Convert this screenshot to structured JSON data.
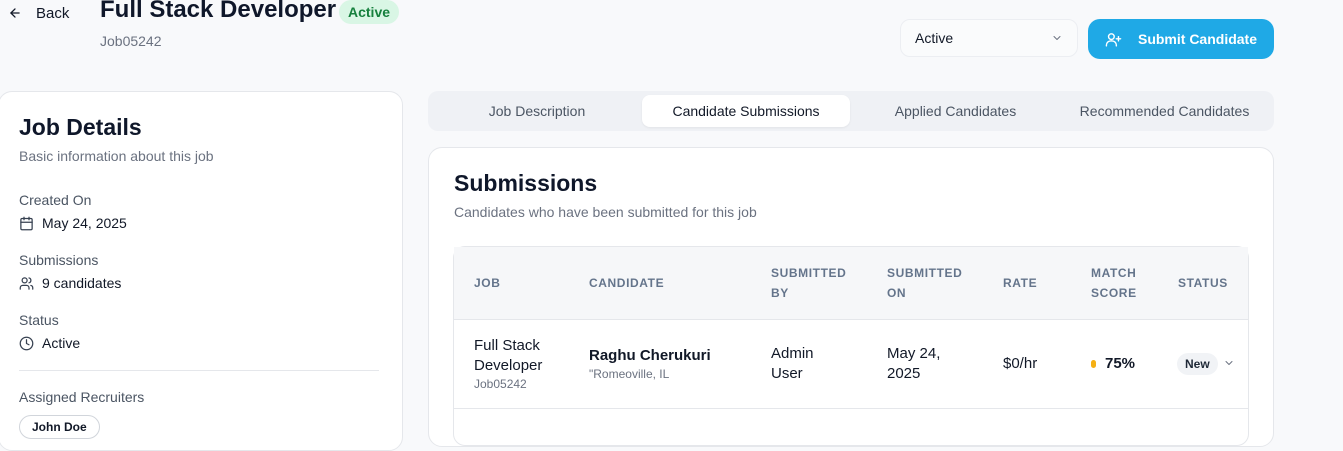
{
  "header": {
    "back_label": "Back",
    "title": "Full Stack Developer",
    "status_badge": "Active",
    "job_id": "Job05242",
    "status_select_value": "Active",
    "submit_label": "Submit Candidate"
  },
  "job_details": {
    "title": "Job Details",
    "subtitle": "Basic information about this job",
    "created_label": "Created On",
    "created_value": "May 24, 2025",
    "submissions_label": "Submissions",
    "submissions_value": "9 candidates",
    "status_label": "Status",
    "status_value": "Active",
    "recruiters_label": "Assigned Recruiters",
    "recruiters": [
      "John Doe"
    ]
  },
  "tabs": [
    {
      "label": "Job Description",
      "active": false
    },
    {
      "label": "Candidate Submissions",
      "active": true
    },
    {
      "label": "Applied Candidates",
      "active": false
    },
    {
      "label": "Recommended Candidates",
      "active": false
    }
  ],
  "submissions": {
    "title": "Submissions",
    "description": "Candidates who have been submitted for this job",
    "columns": [
      [
        "JOB"
      ],
      [
        "CANDIDATE"
      ],
      [
        "SUBMITTED",
        "BY"
      ],
      [
        "SUBMITTED",
        "ON"
      ],
      [
        "RATE"
      ],
      [
        "MATCH",
        "SCORE"
      ],
      [
        "STATUS"
      ]
    ],
    "rows": [
      {
        "job_title_line1": "Full Stack",
        "job_title_line2": "Developer",
        "job_id": "Job05242",
        "candidate_name": "Raghu Cherukuri",
        "candidate_location": "\"Romeoville, IL",
        "submitted_by_line1": "Admin",
        "submitted_by_line2": "User",
        "submitted_on_line1": "May 24,",
        "submitted_on_line2": "2025",
        "rate": "$0/hr",
        "match_score": "75%",
        "status": "New"
      }
    ]
  },
  "colors": {
    "accent": "#1fa9e6",
    "active_badge_bg": "#d9f6e5",
    "active_badge_text": "#15803d",
    "score_dot": "#f5b014"
  },
  "icons": {
    "back": "arrow-left-icon",
    "select": "chevron-down-icon",
    "submit": "user-plus-icon",
    "created": "calendar-icon",
    "submissions": "users-icon",
    "status": "clock-icon"
  }
}
